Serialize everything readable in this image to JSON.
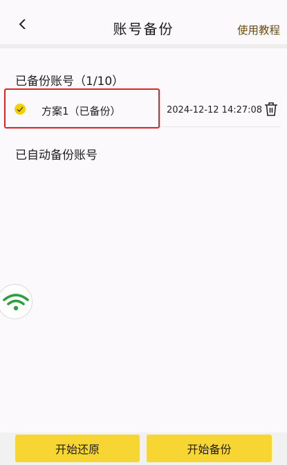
{
  "header": {
    "title": "账号备份",
    "tutorial_link": "使用教程"
  },
  "backed_up": {
    "section_title": "已备份账号（1/10）",
    "items": [
      {
        "name": "方案1（已备份）",
        "time": "2024-12-12 14:27:08"
      }
    ]
  },
  "auto_backup": {
    "section_title": "已自动备份账号"
  },
  "footer": {
    "restore_label": "开始还原",
    "backup_label": "开始备份"
  },
  "colors": {
    "accent": "#f7d634",
    "highlight_border": "#e12222",
    "wifi": "#2e9e3e"
  },
  "icons": [
    "back-arrow-icon",
    "check-icon",
    "trash-icon",
    "wifi-icon"
  ]
}
